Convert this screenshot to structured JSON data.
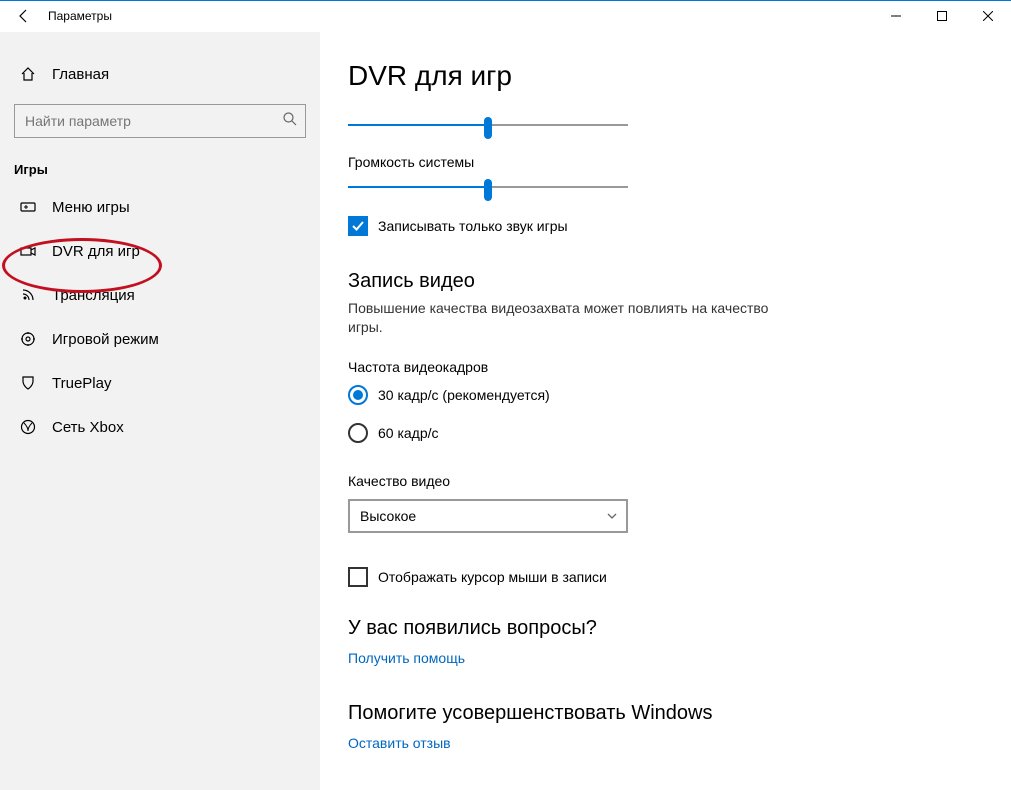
{
  "window": {
    "title": "Параметры"
  },
  "sidebar": {
    "home": "Главная",
    "search_placeholder": "Найти параметр",
    "category": "Игры",
    "items": [
      {
        "label": "Меню игры"
      },
      {
        "label": "DVR для игр"
      },
      {
        "label": "Трансляция"
      },
      {
        "label": "Игровой режим"
      },
      {
        "label": "TruePlay"
      },
      {
        "label": "Сеть Xbox"
      }
    ]
  },
  "main": {
    "title": "DVR для игр",
    "slider2_label": "Громкость системы",
    "record_game_only": "Записывать только звук игры",
    "video_section": "Запись видео",
    "video_desc": "Повышение качества видеозахвата может повлиять на качество игры.",
    "fps_label": "Частота видеокадров",
    "fps_30": "30 кадр/с (рекомендуется)",
    "fps_60": "60 кадр/с",
    "quality_label": "Качество видео",
    "quality_value": "Высокое",
    "cursor_label": "Отображать курсор мыши в записи",
    "help_heading": "У вас появились вопросы?",
    "help_link": "Получить помощь",
    "feedback_heading": "Помогите усовершенствовать Windows",
    "feedback_link": "Оставить отзыв"
  }
}
